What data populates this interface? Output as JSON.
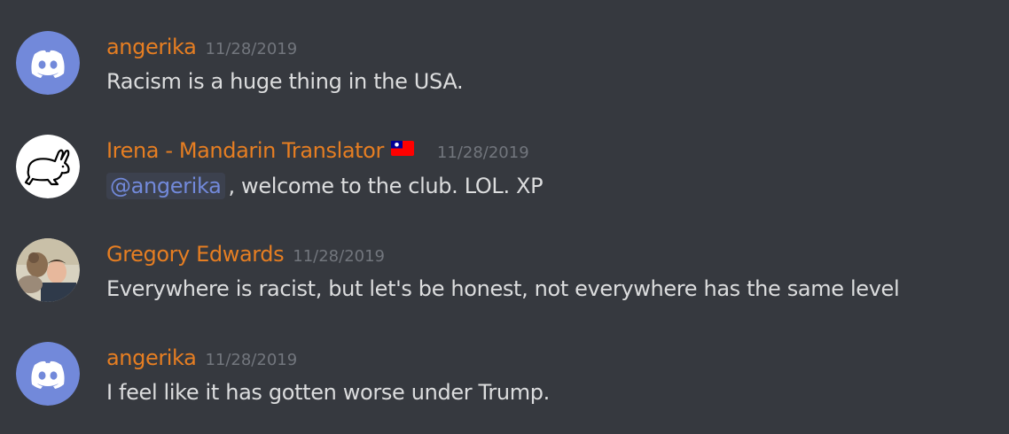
{
  "colors": {
    "background": "#36393f",
    "username": "#e67e22",
    "timestamp": "#72767d",
    "text": "#dcddde",
    "mention": "#7289da",
    "discord_blurple": "#7289da"
  },
  "messages": [
    {
      "username": "angerika",
      "timestamp": "11/28/2019",
      "text": "Racism is a huge thing in the USA.",
      "avatar_icon": "discord-default-avatar-icon"
    },
    {
      "username": "Irena - Mandarin Translator",
      "flag_icon": "taiwan-flag-icon",
      "timestamp": "11/28/2019",
      "mention": "@angerika",
      "text": ", welcome to the club. LOL. XP",
      "avatar_icon": "rabbit-avatar-icon"
    },
    {
      "username": "Gregory Edwards",
      "timestamp": "11/28/2019",
      "text": "Everywhere is racist, but let's be honest, not everywhere has the same level",
      "avatar_icon": "photo-avatar-icon"
    },
    {
      "username": "angerika",
      "timestamp": "11/28/2019",
      "text": "I feel like it has gotten worse under Trump.",
      "avatar_icon": "discord-default-avatar-icon"
    }
  ]
}
